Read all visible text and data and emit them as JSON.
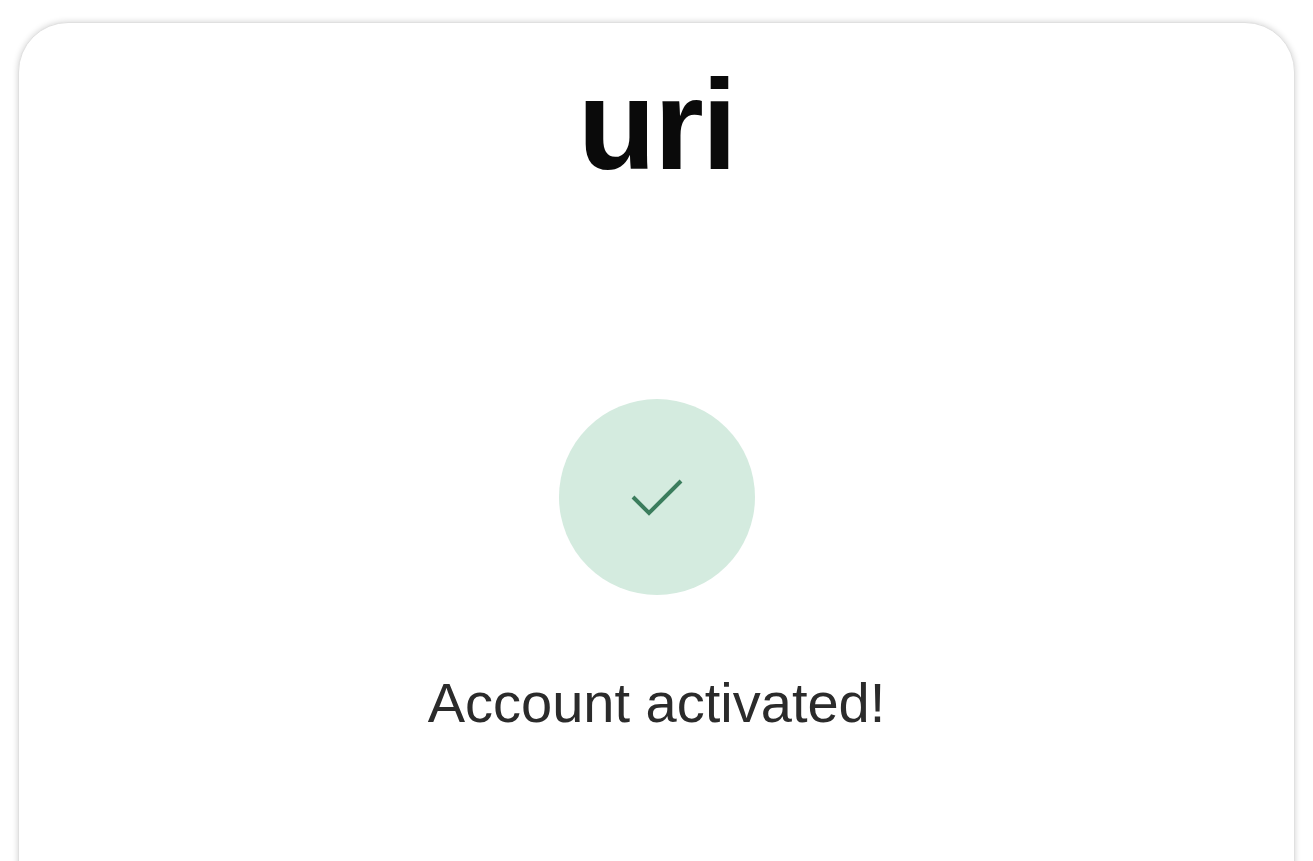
{
  "logo": {
    "text": "uri"
  },
  "status": {
    "kind": "success",
    "message": "Account activated!"
  }
}
